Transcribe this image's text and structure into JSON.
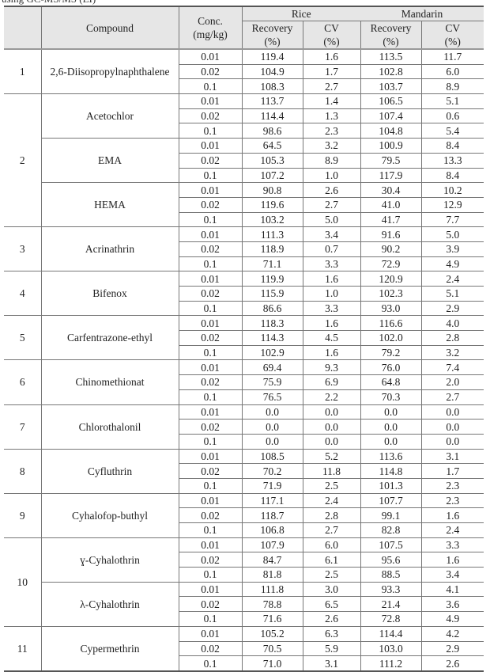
{
  "caption": "using GC-MS/MS (EI)",
  "header": {
    "compound": "Compound",
    "conc": [
      "Conc.",
      "(mg/kg)"
    ],
    "rice": "Rice",
    "mandarin": "Mandarin",
    "recovery": "Recovery",
    "cv": "CV",
    "pct": "(%)"
  },
  "groups": [
    {
      "no": "1",
      "compounds": [
        {
          "name": "2,6-Diisopropylnaphthalene",
          "rows": [
            {
              "conc": "0.01",
              "rice_rec": "119.4",
              "rice_cv": "1.6",
              "man_rec": "113.5",
              "man_cv": "11.7"
            },
            {
              "conc": "0.02",
              "rice_rec": "104.9",
              "rice_cv": "1.7",
              "man_rec": "102.8",
              "man_cv": "6.0"
            },
            {
              "conc": "0.1",
              "rice_rec": "108.3",
              "rice_cv": "2.7",
              "man_rec": "103.7",
              "man_cv": "8.9"
            }
          ]
        }
      ]
    },
    {
      "no": "2",
      "compounds": [
        {
          "name": "Acetochlor",
          "rows": [
            {
              "conc": "0.01",
              "rice_rec": "113.7",
              "rice_cv": "1.4",
              "man_rec": "106.5",
              "man_cv": "5.1"
            },
            {
              "conc": "0.02",
              "rice_rec": "114.4",
              "rice_cv": "1.3",
              "man_rec": "107.4",
              "man_cv": "0.6"
            },
            {
              "conc": "0.1",
              "rice_rec": "98.6",
              "rice_cv": "2.3",
              "man_rec": "104.8",
              "man_cv": "5.4"
            }
          ]
        },
        {
          "name": "EMA",
          "rows": [
            {
              "conc": "0.01",
              "rice_rec": "64.5",
              "rice_cv": "3.2",
              "man_rec": "100.9",
              "man_cv": "8.4"
            },
            {
              "conc": "0.02",
              "rice_rec": "105.3",
              "rice_cv": "8.9",
              "man_rec": "79.5",
              "man_cv": "13.3"
            },
            {
              "conc": "0.1",
              "rice_rec": "107.2",
              "rice_cv": "1.0",
              "man_rec": "117.9",
              "man_cv": "8.4"
            }
          ]
        },
        {
          "name": "HEMA",
          "rows": [
            {
              "conc": "0.01",
              "rice_rec": "90.8",
              "rice_cv": "2.6",
              "man_rec": "30.4",
              "man_cv": "10.2"
            },
            {
              "conc": "0.02",
              "rice_rec": "119.6",
              "rice_cv": "2.7",
              "man_rec": "41.0",
              "man_cv": "12.9"
            },
            {
              "conc": "0.1",
              "rice_rec": "103.2",
              "rice_cv": "5.0",
              "man_rec": "41.7",
              "man_cv": "7.7"
            }
          ]
        }
      ]
    },
    {
      "no": "3",
      "compounds": [
        {
          "name": "Acrinathrin",
          "rows": [
            {
              "conc": "0.01",
              "rice_rec": "111.3",
              "rice_cv": "3.4",
              "man_rec": "91.6",
              "man_cv": "5.0"
            },
            {
              "conc": "0.02",
              "rice_rec": "118.9",
              "rice_cv": "0.7",
              "man_rec": "90.2",
              "man_cv": "3.9"
            },
            {
              "conc": "0.1",
              "rice_rec": "71.1",
              "rice_cv": "3.3",
              "man_rec": "72.9",
              "man_cv": "4.9"
            }
          ]
        }
      ]
    },
    {
      "no": "4",
      "compounds": [
        {
          "name": "Bifenox",
          "rows": [
            {
              "conc": "0.01",
              "rice_rec": "119.9",
              "rice_cv": "1.6",
              "man_rec": "120.9",
              "man_cv": "2.4"
            },
            {
              "conc": "0.02",
              "rice_rec": "115.9",
              "rice_cv": "1.0",
              "man_rec": "102.3",
              "man_cv": "5.1"
            },
            {
              "conc": "0.1",
              "rice_rec": "86.6",
              "rice_cv": "3.3",
              "man_rec": "93.0",
              "man_cv": "2.9"
            }
          ]
        }
      ]
    },
    {
      "no": "5",
      "compounds": [
        {
          "name": "Carfentrazone-ethyl",
          "rows": [
            {
              "conc": "0.01",
              "rice_rec": "118.3",
              "rice_cv": "1.6",
              "man_rec": "116.6",
              "man_cv": "4.0"
            },
            {
              "conc": "0.02",
              "rice_rec": "114.3",
              "rice_cv": "4.5",
              "man_rec": "102.0",
              "man_cv": "2.8"
            },
            {
              "conc": "0.1",
              "rice_rec": "102.9",
              "rice_cv": "1.6",
              "man_rec": "79.2",
              "man_cv": "3.2"
            }
          ]
        }
      ]
    },
    {
      "no": "6",
      "compounds": [
        {
          "name": "Chinomethionat",
          "rows": [
            {
              "conc": "0.01",
              "rice_rec": "69.4",
              "rice_cv": "9.3",
              "man_rec": "76.0",
              "man_cv": "7.4"
            },
            {
              "conc": "0.02",
              "rice_rec": "75.9",
              "rice_cv": "6.9",
              "man_rec": "64.8",
              "man_cv": "2.0"
            },
            {
              "conc": "0.1",
              "rice_rec": "76.5",
              "rice_cv": "2.2",
              "man_rec": "70.3",
              "man_cv": "2.7"
            }
          ]
        }
      ]
    },
    {
      "no": "7",
      "compounds": [
        {
          "name": "Chlorothalonil",
          "rows": [
            {
              "conc": "0.01",
              "rice_rec": "0.0",
              "rice_cv": "0.0",
              "man_rec": "0.0",
              "man_cv": "0.0"
            },
            {
              "conc": "0.02",
              "rice_rec": "0.0",
              "rice_cv": "0.0",
              "man_rec": "0.0",
              "man_cv": "0.0"
            },
            {
              "conc": "0.1",
              "rice_rec": "0.0",
              "rice_cv": "0.0",
              "man_rec": "0.0",
              "man_cv": "0.0"
            }
          ]
        }
      ]
    },
    {
      "no": "8",
      "compounds": [
        {
          "name": "Cyfluthrin",
          "rows": [
            {
              "conc": "0.01",
              "rice_rec": "108.5",
              "rice_cv": "5.2",
              "man_rec": "113.6",
              "man_cv": "3.1"
            },
            {
              "conc": "0.02",
              "rice_rec": "70.2",
              "rice_cv": "11.8",
              "man_rec": "114.8",
              "man_cv": "1.7"
            },
            {
              "conc": "0.1",
              "rice_rec": "71.9",
              "rice_cv": "2.5",
              "man_rec": "101.3",
              "man_cv": "2.3"
            }
          ]
        }
      ]
    },
    {
      "no": "9",
      "compounds": [
        {
          "name": "Cyhalofop-buthyl",
          "rows": [
            {
              "conc": "0.01",
              "rice_rec": "117.1",
              "rice_cv": "2.4",
              "man_rec": "107.7",
              "man_cv": "2.3"
            },
            {
              "conc": "0.02",
              "rice_rec": "118.7",
              "rice_cv": "2.8",
              "man_rec": "99.1",
              "man_cv": "1.6"
            },
            {
              "conc": "0.1",
              "rice_rec": "106.8",
              "rice_cv": "2.7",
              "man_rec": "82.8",
              "man_cv": "2.4"
            }
          ]
        }
      ]
    },
    {
      "no": "10",
      "compounds": [
        {
          "name": "ɣ-Cyhalothrin",
          "rows": [
            {
              "conc": "0.01",
              "rice_rec": "107.9",
              "rice_cv": "6.0",
              "man_rec": "107.5",
              "man_cv": "3.3"
            },
            {
              "conc": "0.02",
              "rice_rec": "84.7",
              "rice_cv": "6.1",
              "man_rec": "95.6",
              "man_cv": "1.6"
            },
            {
              "conc": "0.1",
              "rice_rec": "81.8",
              "rice_cv": "2.5",
              "man_rec": "88.5",
              "man_cv": "3.4"
            }
          ]
        },
        {
          "name": "λ-Cyhalothrin",
          "rows": [
            {
              "conc": "0.01",
              "rice_rec": "111.8",
              "rice_cv": "3.0",
              "man_rec": "93.3",
              "man_cv": "4.1"
            },
            {
              "conc": "0.02",
              "rice_rec": "78.8",
              "rice_cv": "6.5",
              "man_rec": "21.4",
              "man_cv": "3.6"
            },
            {
              "conc": "0.1",
              "rice_rec": "71.6",
              "rice_cv": "2.6",
              "man_rec": "72.8",
              "man_cv": "4.9"
            }
          ]
        }
      ]
    },
    {
      "no": "11",
      "compounds": [
        {
          "name": "Cypermethrin",
          "rows": [
            {
              "conc": "0.01",
              "rice_rec": "105.2",
              "rice_cv": "6.3",
              "man_rec": "114.4",
              "man_cv": "4.2"
            },
            {
              "conc": "0.02",
              "rice_rec": "70.5",
              "rice_cv": "5.9",
              "man_rec": "103.0",
              "man_cv": "2.9"
            },
            {
              "conc": "0.1",
              "rice_rec": "71.0",
              "rice_cv": "3.1",
              "man_rec": "111.2",
              "man_cv": "2.6"
            }
          ]
        }
      ]
    }
  ]
}
